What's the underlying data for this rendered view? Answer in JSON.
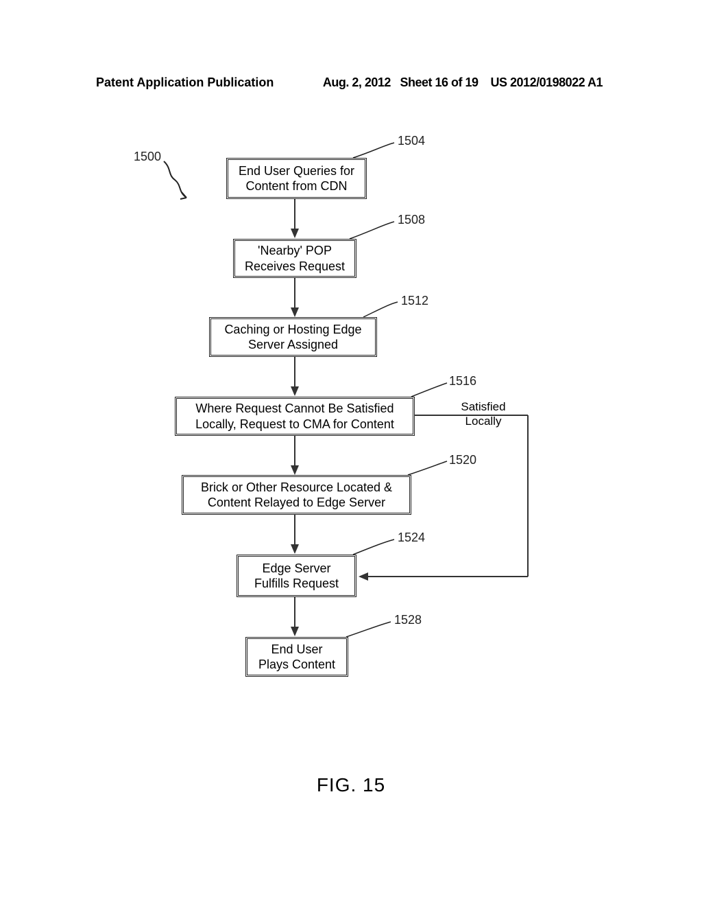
{
  "header": {
    "publication": "Patent Application Publication",
    "date": "Aug. 2, 2012",
    "sheet": "Sheet 16 of 19",
    "doc_number": "US 2012/0198022 A1"
  },
  "figure_caption": "FIG. 15",
  "refs": {
    "r1500": "1500",
    "r1504": "1504",
    "r1508": "1508",
    "r1512": "1512",
    "r1516": "1516",
    "r1520": "1520",
    "r1524": "1524",
    "r1528": "1528"
  },
  "boxes": {
    "b1504": "End User Queries for Content from CDN",
    "b1508": "'Nearby' POP Receives Request",
    "b1512": "Caching or Hosting Edge Server Assigned",
    "b1516": "Where Request Cannot Be Satisfied Locally, Request to CMA for Content",
    "b1520": "Brick or Other Resource Located & Content Relayed to Edge Server",
    "b1524": "Edge Server Fulfills Request",
    "b1528": "End User Plays Content"
  },
  "side_label": "Satisfied Locally"
}
